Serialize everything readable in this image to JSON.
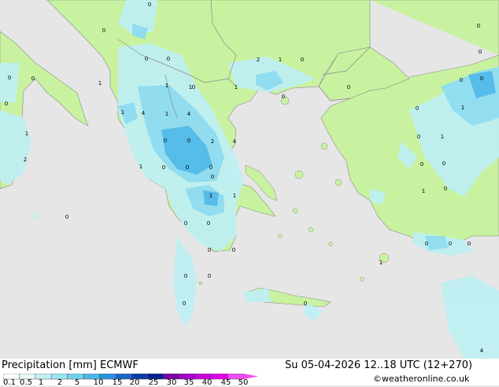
{
  "map": {
    "colors": {
      "sea": "#e6e6e6",
      "land": "#c8f2a0",
      "precip_light": "#bfeff2",
      "precip_mid": "#8fdcf0",
      "precip_heavy": "#50b8e8",
      "border": "#888888"
    },
    "value_labels": [
      "0",
      "0",
      "0",
      "0",
      "0",
      "0",
      "2",
      "1",
      "0",
      "1",
      "1",
      "1",
      "1",
      "1",
      "4",
      "1",
      "4",
      "0",
      "0",
      "2",
      "4",
      "1",
      "0",
      "0",
      "0",
      "1",
      "1",
      "0",
      "0",
      "0",
      "0",
      "0",
      "0",
      "0",
      "0",
      "0",
      "1",
      "2",
      "0",
      "0",
      "0",
      "0",
      "0",
      "0",
      "1",
      "0",
      "0",
      "1",
      "0",
      "0",
      "0",
      "1",
      "0",
      "0",
      "0",
      "1",
      "4",
      "0",
      "0",
      "0"
    ]
  },
  "footer": {
    "title": "Precipitation [mm]  ECMWF",
    "datetime": "Su 05-04-2026 12..18 UTC (12+270)",
    "credit": "©weatheronline.co.uk"
  },
  "legend": {
    "ticks": [
      "0.1",
      "0.5",
      "1",
      "2",
      "5",
      "10",
      "15",
      "20",
      "25",
      "30",
      "35",
      "40",
      "45",
      "50"
    ],
    "colors": [
      "#ffffff",
      "#e6fbfb",
      "#bfeff2",
      "#9ae4f0",
      "#72d2ee",
      "#4bb6e8",
      "#2a92dc",
      "#1a66c4",
      "#0c3aa8",
      "#06208c",
      "#7a00a6",
      "#a400c8",
      "#c800d8",
      "#e000e6",
      "#f04ef4"
    ]
  }
}
